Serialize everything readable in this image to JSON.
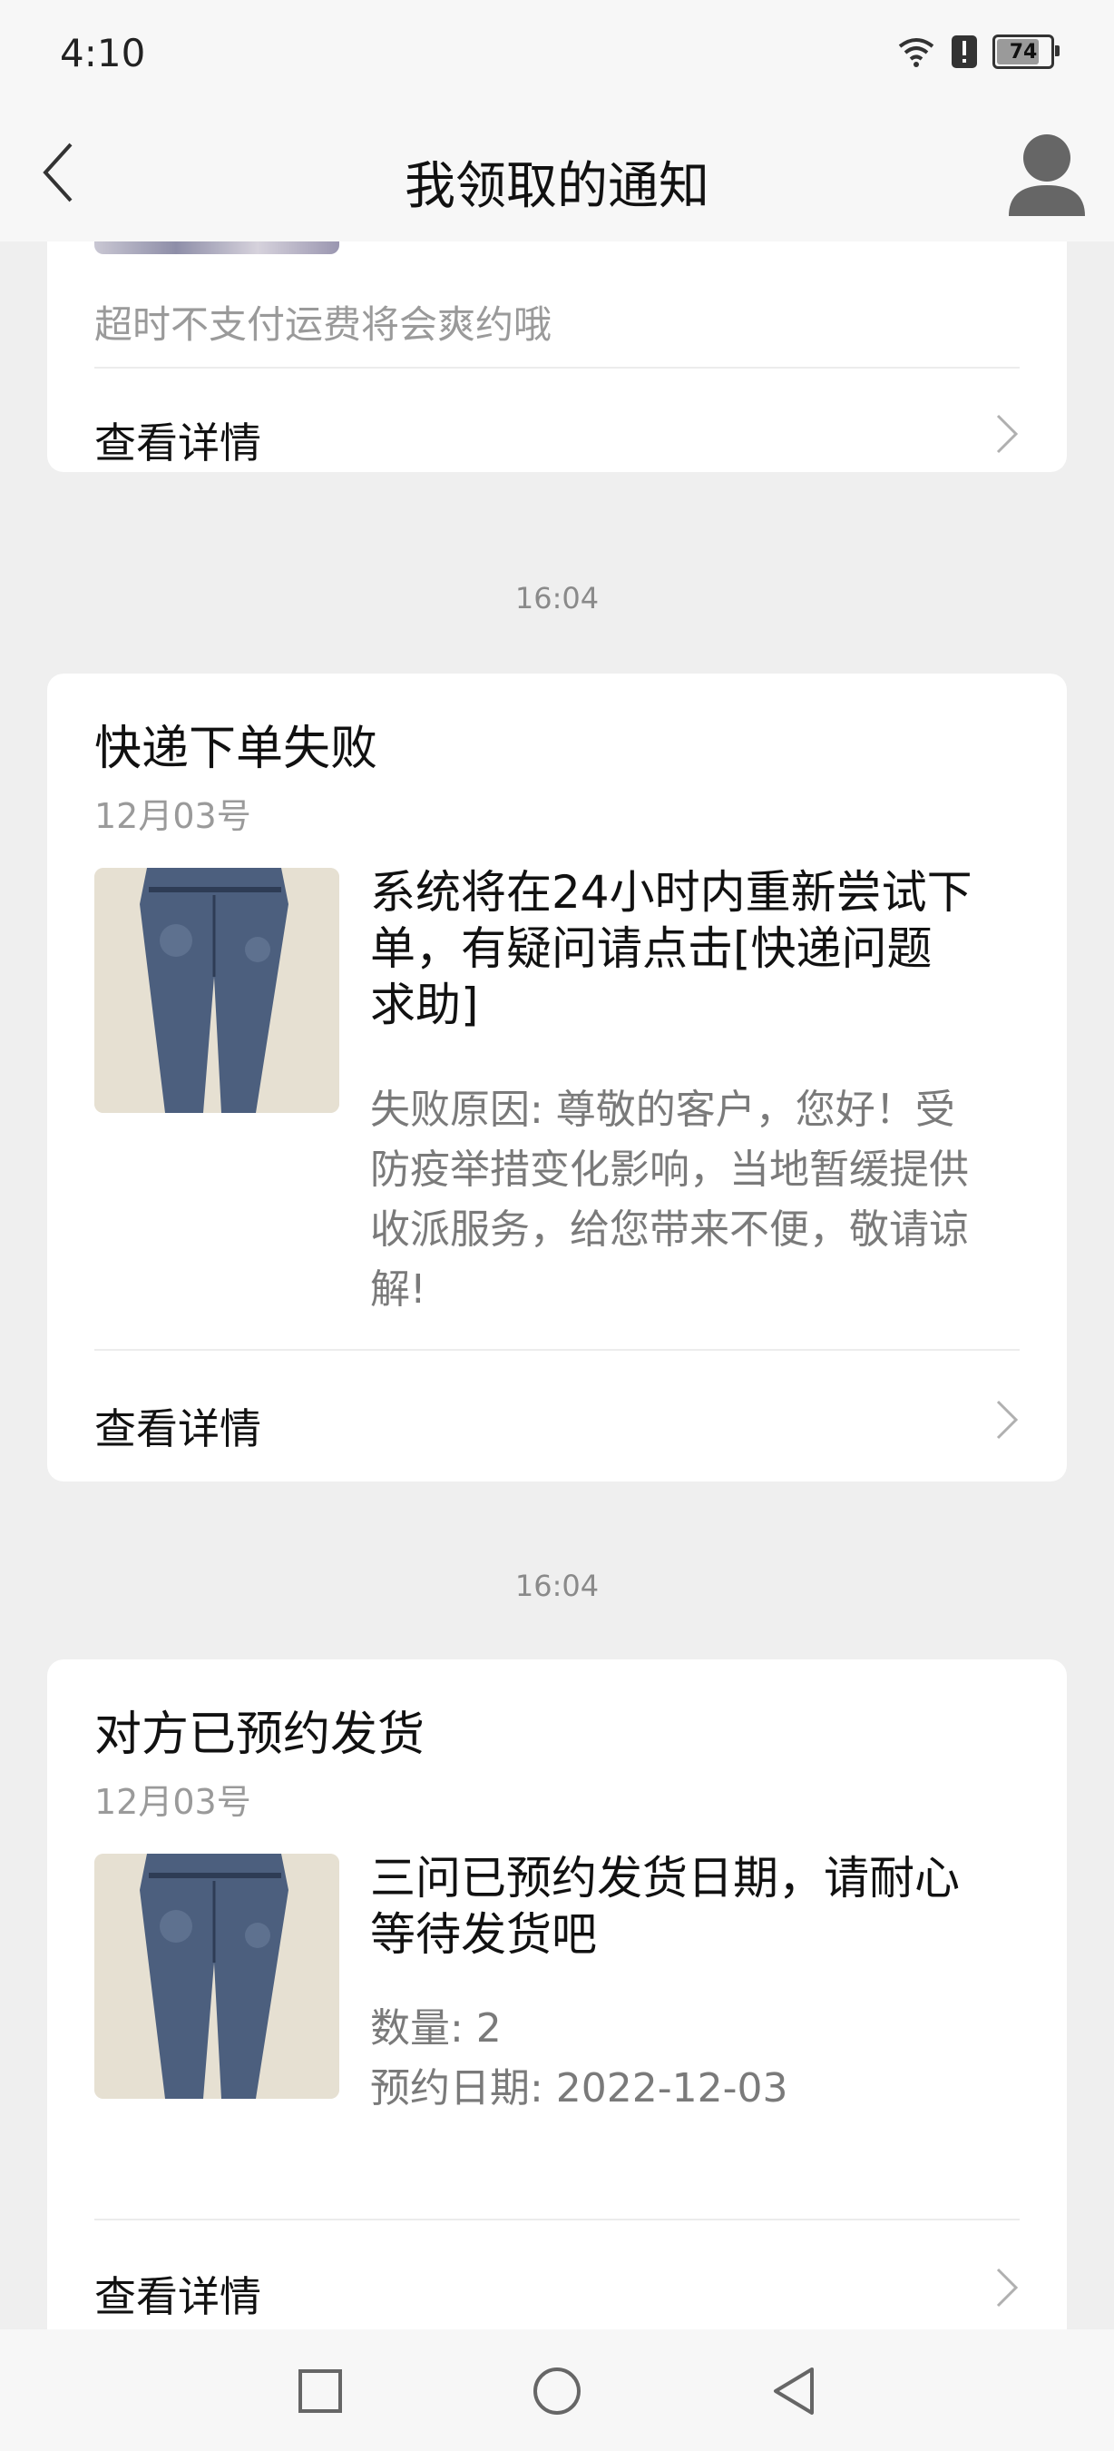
{
  "status": {
    "time": "4:10",
    "battery": "74"
  },
  "header": {
    "title": "我领取的通知"
  },
  "top_card": {
    "note": "超时不支付运费将会爽约哦",
    "detail_label": "查看详情"
  },
  "cards": [
    {
      "time": "16:04",
      "title": "快递下单失败",
      "date": "12月03号",
      "headline_lines": [
        "系统将在24小时内重新尝试下",
        "单，有疑问请点击[快递问题",
        "求助]"
      ],
      "desc_lines": [
        "失败原因: 尊敬的客户，您好！受",
        "防疫举措变化影响，当地暂缓提供",
        "收派服务，给您带来不便，敬请谅",
        "解!"
      ],
      "detail_label": "查看详情"
    },
    {
      "time": "16:04",
      "title": "对方已预约发货",
      "date": "12月03号",
      "headline_lines": [
        "三问已预约发货日期，请耐心",
        "等待发货吧"
      ],
      "desc_lines": [
        "数量: 2",
        "预约日期: 2022-12-03"
      ],
      "detail_label": "查看详情"
    }
  ],
  "colors": {
    "background": "#efefef",
    "card": "#ffffff",
    "muted_text": "#7a7a7a"
  },
  "icons": [
    "back-arrow-icon",
    "user-icon",
    "wifi-icon",
    "alert-icon",
    "battery-icon",
    "chevron-right-icon",
    "square-nav-icon",
    "circle-nav-icon",
    "triangle-back-nav-icon"
  ]
}
